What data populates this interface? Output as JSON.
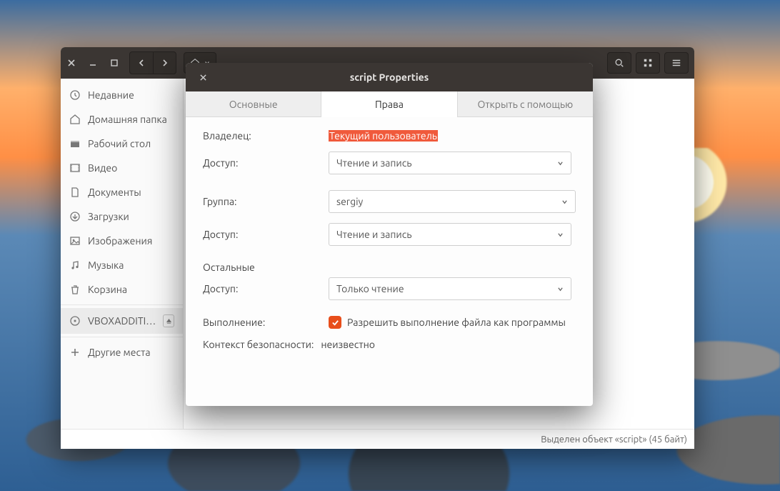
{
  "wallpaper": {
    "note": "sunset beach with stacked stones"
  },
  "fm": {
    "sidebar": {
      "items": [
        {
          "icon": "clock",
          "label": "Недавние"
        },
        {
          "icon": "home",
          "label": "Домашняя папка"
        },
        {
          "icon": "desktop",
          "label": "Рабочий стол"
        },
        {
          "icon": "video",
          "label": "Видео"
        },
        {
          "icon": "document",
          "label": "Документы"
        },
        {
          "icon": "download",
          "label": "Загрузки"
        },
        {
          "icon": "pictures",
          "label": "Изображения"
        },
        {
          "icon": "music",
          "label": "Музыка"
        },
        {
          "icon": "trash",
          "label": "Корзина"
        }
      ],
      "volume": {
        "label": "VBOXADDITI…"
      },
      "other": {
        "label": "Другие места"
      }
    },
    "status": "Выделен объект «script»  (45 байт)"
  },
  "dlg": {
    "title": "script Properties",
    "tabs": [
      "Основные",
      "Права",
      "Открыть с помощью"
    ],
    "active_tab": 1,
    "owner_label": "Владелец:",
    "owner_value": "Текущий пользователь",
    "access_label": "Доступ:",
    "owner_access": "Чтение и запись",
    "group_label": "Группа:",
    "group_value": "sergiy",
    "group_access": "Чтение и запись",
    "others_label": "Остальные",
    "others_access": "Только чтение",
    "exec_label": "Выполнение:",
    "exec_checkbox": "Разрешить выполнение файла как программы",
    "sec_label": "Контекст безопасности:",
    "sec_value": "неизвестно"
  }
}
